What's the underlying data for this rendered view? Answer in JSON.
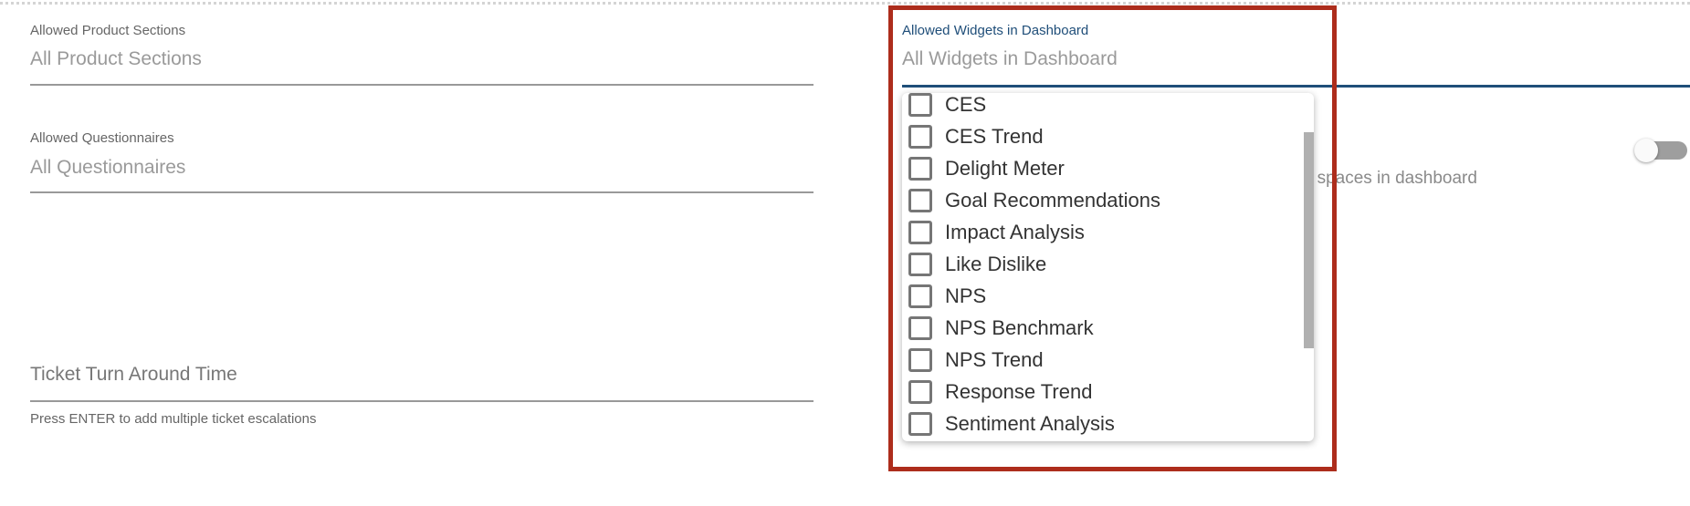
{
  "left_column": {
    "product_sections": {
      "label": "Allowed Product Sections",
      "value": "All Product Sections"
    },
    "questionnaires": {
      "label": "Allowed Questionnaires",
      "value": "All Questionnaires"
    },
    "ticket_tat": {
      "placeholder": "Ticket Turn Around Time",
      "help": "Press ENTER to add multiple ticket escalations"
    }
  },
  "widgets": {
    "label": "Allowed Widgets in Dashboard",
    "value": "All Widgets in Dashboard",
    "options": [
      {
        "label": "CES",
        "checked": false
      },
      {
        "label": "CES Trend",
        "checked": false
      },
      {
        "label": "Delight Meter",
        "checked": false
      },
      {
        "label": "Goal Recommendations",
        "checked": false
      },
      {
        "label": "Impact Analysis",
        "checked": false
      },
      {
        "label": "Like Dislike",
        "checked": false
      },
      {
        "label": "NPS",
        "checked": false
      },
      {
        "label": "NPS Benchmark",
        "checked": false
      },
      {
        "label": "NPS Trend",
        "checked": false
      },
      {
        "label": "Response Trend",
        "checked": false
      },
      {
        "label": "Sentiment Analysis",
        "checked": false
      }
    ]
  },
  "partial_setting": {
    "text": "wn spaces in dashboard",
    "toggle_on": false
  },
  "colors": {
    "accent": "#1f4e79",
    "highlight_box": "#ad2d1c"
  }
}
